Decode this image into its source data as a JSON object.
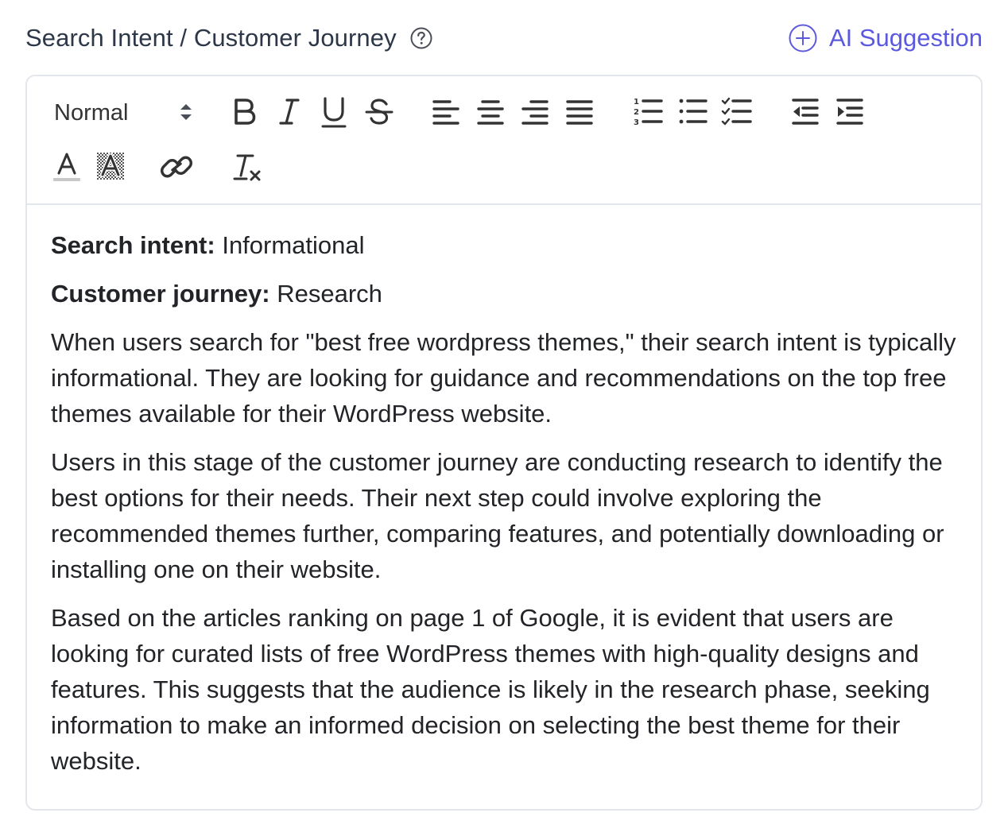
{
  "header": {
    "title": "Search Intent / Customer Journey",
    "help_icon": "question-circle-icon",
    "ai_button_label": "AI Suggestion",
    "ai_button_icon": "plus-circle-icon"
  },
  "colors": {
    "accent": "#5b59e0",
    "border": "#e3e6ea",
    "text": "#222428",
    "icon": "#333333"
  },
  "toolbar": {
    "format_value": "Normal",
    "buttons": [
      "bold-icon",
      "italic-icon",
      "underline-icon",
      "strikethrough-icon",
      "align-left-icon",
      "align-center-icon",
      "align-right-icon",
      "align-justify-icon",
      "ordered-list-icon",
      "bullet-list-icon",
      "checklist-icon",
      "outdent-icon",
      "indent-icon",
      "text-color-icon",
      "highlight-color-icon",
      "link-icon",
      "clear-format-icon"
    ]
  },
  "content": {
    "intent_label": "Search intent:",
    "intent_value": " Informational",
    "journey_label": "Customer journey:",
    "journey_value": " Research",
    "paragraphs": [
      "When users search for \"best free wordpress themes,\" their search intent is typically informational. They are looking for guidance and recommendations on the top free themes available for their WordPress website.",
      "Users in this stage of the customer journey are conducting research to identify the best options for their needs. Their next step could involve exploring the recommended themes further, comparing features, and potentially downloading or installing one on their website.",
      "Based on the articles ranking on page 1 of Google, it is evident that users are looking for curated lists of free WordPress themes with high-quality designs and features. This suggests that the audience is likely in the research phase, seeking information to make an informed decision on selecting the best theme for their website."
    ]
  }
}
